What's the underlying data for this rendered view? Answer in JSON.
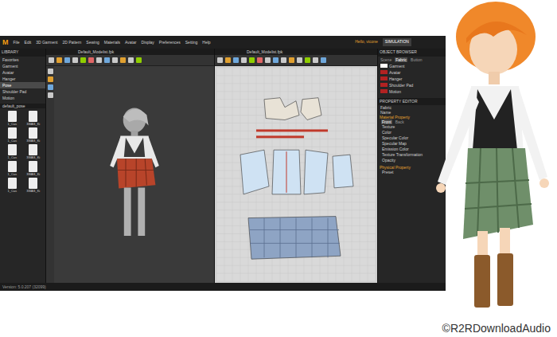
{
  "app": {
    "logo": "M",
    "menu": [
      "File",
      "Edit",
      "3D Garment",
      "2D Pattern",
      "Sewing",
      "Materials",
      "Avatar",
      "Display",
      "Preferences",
      "Setting",
      "Help"
    ],
    "user": "Hello, vicone",
    "mode": "SIMULATION"
  },
  "library": {
    "title": "LIBRARY",
    "items": [
      {
        "label": "Favorites",
        "selected": false
      },
      {
        "label": "Garment",
        "selected": false
      },
      {
        "label": "Avatar",
        "selected": false
      },
      {
        "label": "Hanger",
        "selected": false
      },
      {
        "label": "Pose",
        "selected": true
      },
      {
        "label": "Shoulder Pad",
        "selected": false
      },
      {
        "label": "Motion",
        "selected": false
      }
    ],
    "folder": "default_pose",
    "thumbnails": [
      "1_Cas",
      "3WAS_Ki",
      "1_Cas",
      "3WAS_Ki",
      "1_Cas",
      "3WAS_Ki",
      "1_Cas",
      "3WAS_Ki",
      "1_Cas",
      "3WAS_Ki"
    ]
  },
  "window3d": {
    "tab": "Default_Modelist.fpk"
  },
  "window2d": {
    "tab": "Default_Modelist.fpk"
  },
  "object_browser": {
    "title": "OBJECT BROWSER",
    "tabs": [
      {
        "label": "Scene",
        "selected": false
      },
      {
        "label": "Fabric",
        "selected": true
      },
      {
        "label": "Button",
        "selected": false
      }
    ],
    "items": [
      {
        "label": "Garment",
        "color": "#ffffff"
      },
      {
        "label": "Avatar",
        "color": "#b22222"
      },
      {
        "label": "Hanger",
        "color": "#b22222"
      },
      {
        "label": "Shoulder Pad",
        "color": "#b22222"
      },
      {
        "label": "Motion",
        "color": "#b22222"
      }
    ]
  },
  "property_editor": {
    "title": "PROPERTY EDITOR",
    "rows": [
      "Fabric",
      "Name"
    ],
    "section": "Material Property",
    "tabs": [
      {
        "label": "Front",
        "selected": true
      },
      {
        "label": "Back",
        "selected": false
      }
    ],
    "props": [
      "Texture",
      "Color",
      "Specular Color",
      "Specular Map",
      "Emission Color",
      "Texture Transformation",
      "Opacity"
    ],
    "section2": "Physical Property",
    "preset": "Preset"
  },
  "status_bar": "Version: 5.0.207 (32099)",
  "watermark": "©R2RDownloadAudio"
}
